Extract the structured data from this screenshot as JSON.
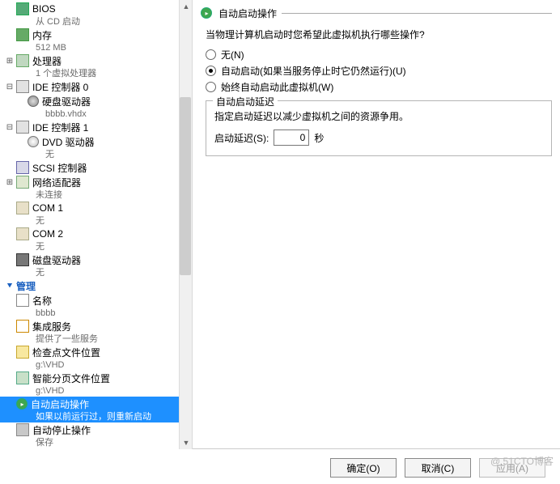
{
  "sidebar": {
    "bios": {
      "label": "BIOS",
      "sub": "从 CD 启动"
    },
    "memory": {
      "label": "内存",
      "sub": "512 MB"
    },
    "cpu": {
      "label": "处理器",
      "sub": "1 个虚拟处理器"
    },
    "ide0": {
      "label": "IDE 控制器 0",
      "hdd": {
        "label": "硬盘驱动器",
        "sub": "bbbb.vhdx"
      }
    },
    "ide1": {
      "label": "IDE 控制器 1",
      "dvd": {
        "label": "DVD 驱动器",
        "sub": "无"
      }
    },
    "scsi": {
      "label": "SCSI 控制器"
    },
    "net": {
      "label": "网络适配器",
      "sub": "未连接"
    },
    "com1": {
      "label": "COM 1",
      "sub": "无"
    },
    "com2": {
      "label": "COM 2",
      "sub": "无"
    },
    "diskette": {
      "label": "磁盘驱动器",
      "sub": "无"
    },
    "management_header": "管理",
    "name": {
      "label": "名称",
      "sub": "bbbb"
    },
    "integration": {
      "label": "集成服务",
      "sub": "提供了一些服务"
    },
    "checkpoint": {
      "label": "检查点文件位置",
      "sub": "g:\\VHD"
    },
    "smartpaging": {
      "label": "智能分页文件位置",
      "sub": "g:\\VHD"
    },
    "autostart": {
      "label": "自动启动操作",
      "sub": "如果以前运行过，则重新启动"
    },
    "autostop": {
      "label": "自动停止操作",
      "sub": "保存"
    }
  },
  "panel": {
    "title": "自动启动操作",
    "subtitle": "当物理计算机启动时您希望此虚拟机执行哪些操作?",
    "opt_none": "无(N)",
    "opt_auto": "自动启动(如果当服务停止时它仍然运行)(U)",
    "opt_always": "始终自动启动此虚拟机(W)",
    "delay_group": "自动启动延迟",
    "delay_hint": "指定启动延迟以减少虚拟机之间的资源争用。",
    "delay_label": "启动延迟(S):",
    "delay_value": "0",
    "delay_unit": "秒"
  },
  "footer": {
    "ok": "确定(O)",
    "cancel": "取消(C)",
    "apply": "应用(A)"
  },
  "watermark": "@ 51CTO博客"
}
